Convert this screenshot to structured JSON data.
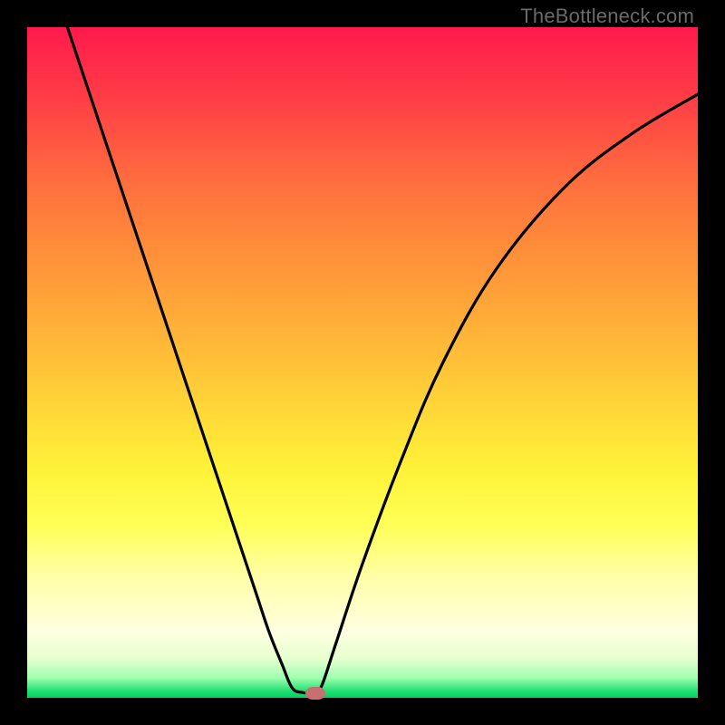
{
  "watermark": "TheBottleneck.com",
  "chart_data": {
    "type": "line",
    "title": "",
    "xlabel": "",
    "ylabel": "",
    "xlim": [
      0,
      100
    ],
    "ylim": [
      0,
      100
    ],
    "series": [
      {
        "name": "bottleneck-curve",
        "x": [
          6,
          10,
          14,
          18,
          22,
          26,
          30,
          34,
          36,
          38,
          39.5,
          41,
          43,
          44,
          46,
          50,
          56,
          62,
          70,
          80,
          90,
          100
        ],
        "values": [
          100,
          88,
          76,
          64,
          52,
          40,
          28,
          16,
          10,
          5,
          1.5,
          0.8,
          0.7,
          2,
          8,
          20,
          36,
          50,
          64,
          76,
          84,
          90
        ]
      }
    ],
    "marker": {
      "x": 43,
      "y": 0.7
    },
    "colors": {
      "gradient_top": "#ff1a4d",
      "gradient_mid": "#fff238",
      "gradient_bottom": "#00d060",
      "curve": "#000000",
      "marker": "#c77070",
      "frame": "#000000"
    }
  }
}
